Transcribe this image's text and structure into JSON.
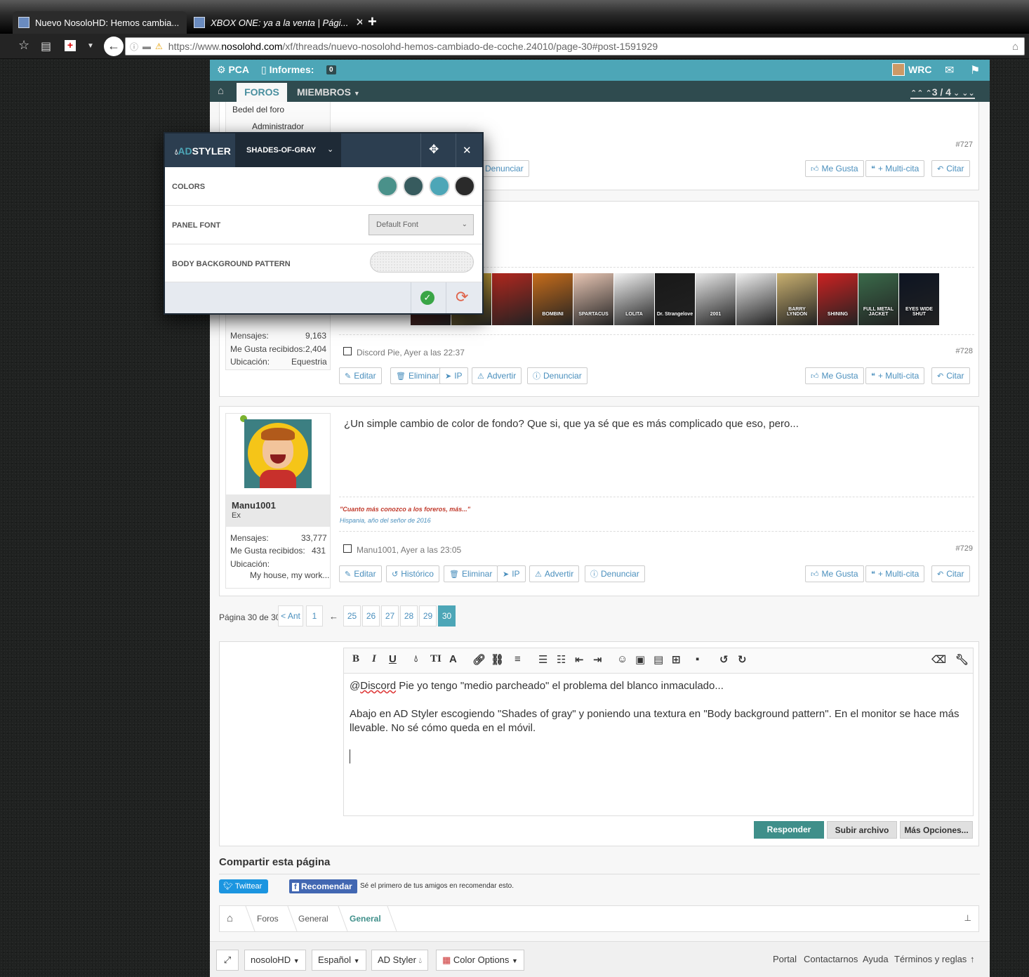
{
  "browser": {
    "tabs": [
      {
        "title": "Nuevo NosoloHD: Hemos cambia..."
      },
      {
        "title": "XBOX ONE: ya a la venta | Pági..."
      }
    ],
    "new_tab_icon": "+",
    "url_prefix": "https://www.",
    "url_domain": "nosolohd.com",
    "url_path": "/xf/threads/nuevo-nosolohd-hemos-cambiado-de-coche.24010/page-30#post-1591929"
  },
  "site_header": {
    "pca": "PCA",
    "informes_label": "Informes:",
    "informes_count": "0",
    "user": "WRC"
  },
  "nav": {
    "foros": "FOROS",
    "miembros": "MIEMBROS",
    "pager": "3 / 4"
  },
  "adstyler": {
    "brand_prefix": "AD",
    "brand_suffix": "STYLER",
    "theme": "SHADES-OF-GRAY",
    "colors_label": "COLORS",
    "panel_font_label": "PANEL FONT",
    "panel_font_value": "Default Font",
    "body_bg_label": "BODY BACKGROUND PATTERN",
    "swatches": [
      "#4a918a",
      "#375b5e",
      "#4da6b7",
      "#2a2a2a"
    ]
  },
  "post727": {
    "role": "Bedel del foro",
    "role2": "Administrador",
    "number": "#727",
    "report": "Denunciar"
  },
  "post728": {
    "stats": [
      {
        "label": "Mensajes:",
        "value": "9,163"
      },
      {
        "label": "Me Gusta recibidos:",
        "value": "2,404"
      },
      {
        "label": "Ubicación:",
        "value": "Equestria"
      }
    ],
    "meta": "Discord Pie, Ayer a las 22:37",
    "number": "#728",
    "actions": [
      "Editar",
      "Eliminar",
      "IP",
      "Advertir",
      "Denunciar"
    ],
    "poster_colors": [
      "#8a1c14",
      "#d8b03a",
      "#b3281f",
      "#c76d1b",
      "#e8c6b4",
      "#f2f2f2",
      "#181818",
      "#e8e8e8",
      "#f0f0f0",
      "#c9b070",
      "#c22",
      "#3a6a4a",
      "#0d1422"
    ],
    "poster_texts": [
      "",
      "",
      "BOMBINI",
      "SPARTACUS",
      "LOLITA",
      "Dr. Strangelove",
      "2001",
      "",
      "BARRY LYNDON",
      "SHINING",
      "FULL METAL JACKET",
      "EYES WIDE SHUT"
    ]
  },
  "post729": {
    "username": "Manu1001",
    "title": "Ex",
    "stats": [
      {
        "label": "Mensajes:",
        "value": "33,777"
      },
      {
        "label": "Me Gusta recibidos:",
        "value": "431"
      },
      {
        "label": "Ubicación:",
        "value": ""
      }
    ],
    "location": "My house, my work...",
    "message": "¿Un simple cambio de color de fondo? Que si, que ya sé que es más complicado que eso, pero...",
    "signature_line1": "\"Cuanto más conozco a los foreros, más...\"",
    "signature_line2": "Hispania, año del señor de 2016",
    "meta": "Manu1001, Ayer a las 23:05",
    "number": "#729",
    "actions": [
      "Editar",
      "Histórico",
      "Eliminar",
      "IP",
      "Advertir",
      "Denunciar"
    ]
  },
  "common_actions": [
    "Me Gusta",
    "+ Multi-cita",
    "Citar"
  ],
  "pagination": {
    "label": "Página 30 de 30",
    "prev": "< Ant",
    "first": "1",
    "ellipsis": "←",
    "pages": [
      "25",
      "26",
      "27",
      "28",
      "29",
      "30"
    ]
  },
  "editor": {
    "line1_a": "@",
    "line1_b": "Discord",
    "line1_c": " Pie yo tengo \"medio parcheado\" el problema del blanco inmaculado...",
    "line2": "Abajo en AD Styler escogiendo \"Shades of gray\" y poniendo una textura en \"Body background pattern\". En el monitor se hace más llevable. No sé cómo queda en el móvil.",
    "reply": "Responder",
    "upload": "Subir archivo",
    "more": "Más Opciones..."
  },
  "share": {
    "title": "Compartir esta página",
    "twitter": "Twittear",
    "facebook": "Recomendar",
    "facebook_note": "Sé el primero de tus amigos en recomendar esto."
  },
  "breadcrumb": [
    "Foros",
    "General",
    "General"
  ],
  "footer": {
    "buttons": [
      "nosoloHD",
      "Español",
      "AD Styler",
      "Color Options"
    ],
    "links": [
      "Portal",
      "Contactarnos",
      "Ayuda",
      "Términos y reglas"
    ]
  }
}
